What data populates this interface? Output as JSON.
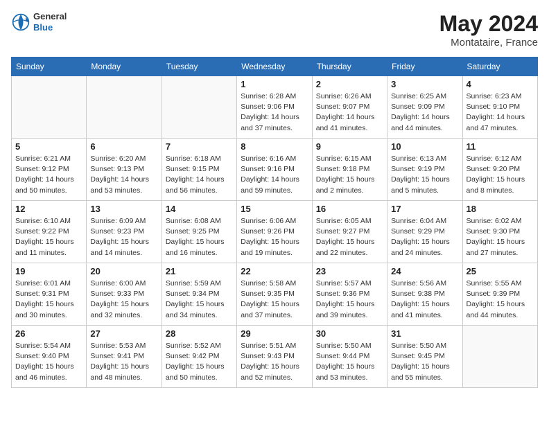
{
  "header": {
    "logo_line1": "General",
    "logo_line2": "Blue",
    "month_year": "May 2024",
    "location": "Montataire, France"
  },
  "weekdays": [
    "Sunday",
    "Monday",
    "Tuesday",
    "Wednesday",
    "Thursday",
    "Friday",
    "Saturday"
  ],
  "weeks": [
    [
      {
        "day": "",
        "info": ""
      },
      {
        "day": "",
        "info": ""
      },
      {
        "day": "",
        "info": ""
      },
      {
        "day": "1",
        "info": "Sunrise: 6:28 AM\nSunset: 9:06 PM\nDaylight: 14 hours\nand 37 minutes."
      },
      {
        "day": "2",
        "info": "Sunrise: 6:26 AM\nSunset: 9:07 PM\nDaylight: 14 hours\nand 41 minutes."
      },
      {
        "day": "3",
        "info": "Sunrise: 6:25 AM\nSunset: 9:09 PM\nDaylight: 14 hours\nand 44 minutes."
      },
      {
        "day": "4",
        "info": "Sunrise: 6:23 AM\nSunset: 9:10 PM\nDaylight: 14 hours\nand 47 minutes."
      }
    ],
    [
      {
        "day": "5",
        "info": "Sunrise: 6:21 AM\nSunset: 9:12 PM\nDaylight: 14 hours\nand 50 minutes."
      },
      {
        "day": "6",
        "info": "Sunrise: 6:20 AM\nSunset: 9:13 PM\nDaylight: 14 hours\nand 53 minutes."
      },
      {
        "day": "7",
        "info": "Sunrise: 6:18 AM\nSunset: 9:15 PM\nDaylight: 14 hours\nand 56 minutes."
      },
      {
        "day": "8",
        "info": "Sunrise: 6:16 AM\nSunset: 9:16 PM\nDaylight: 14 hours\nand 59 minutes."
      },
      {
        "day": "9",
        "info": "Sunrise: 6:15 AM\nSunset: 9:18 PM\nDaylight: 15 hours\nand 2 minutes."
      },
      {
        "day": "10",
        "info": "Sunrise: 6:13 AM\nSunset: 9:19 PM\nDaylight: 15 hours\nand 5 minutes."
      },
      {
        "day": "11",
        "info": "Sunrise: 6:12 AM\nSunset: 9:20 PM\nDaylight: 15 hours\nand 8 minutes."
      }
    ],
    [
      {
        "day": "12",
        "info": "Sunrise: 6:10 AM\nSunset: 9:22 PM\nDaylight: 15 hours\nand 11 minutes."
      },
      {
        "day": "13",
        "info": "Sunrise: 6:09 AM\nSunset: 9:23 PM\nDaylight: 15 hours\nand 14 minutes."
      },
      {
        "day": "14",
        "info": "Sunrise: 6:08 AM\nSunset: 9:25 PM\nDaylight: 15 hours\nand 16 minutes."
      },
      {
        "day": "15",
        "info": "Sunrise: 6:06 AM\nSunset: 9:26 PM\nDaylight: 15 hours\nand 19 minutes."
      },
      {
        "day": "16",
        "info": "Sunrise: 6:05 AM\nSunset: 9:27 PM\nDaylight: 15 hours\nand 22 minutes."
      },
      {
        "day": "17",
        "info": "Sunrise: 6:04 AM\nSunset: 9:29 PM\nDaylight: 15 hours\nand 24 minutes."
      },
      {
        "day": "18",
        "info": "Sunrise: 6:02 AM\nSunset: 9:30 PM\nDaylight: 15 hours\nand 27 minutes."
      }
    ],
    [
      {
        "day": "19",
        "info": "Sunrise: 6:01 AM\nSunset: 9:31 PM\nDaylight: 15 hours\nand 30 minutes."
      },
      {
        "day": "20",
        "info": "Sunrise: 6:00 AM\nSunset: 9:33 PM\nDaylight: 15 hours\nand 32 minutes."
      },
      {
        "day": "21",
        "info": "Sunrise: 5:59 AM\nSunset: 9:34 PM\nDaylight: 15 hours\nand 34 minutes."
      },
      {
        "day": "22",
        "info": "Sunrise: 5:58 AM\nSunset: 9:35 PM\nDaylight: 15 hours\nand 37 minutes."
      },
      {
        "day": "23",
        "info": "Sunrise: 5:57 AM\nSunset: 9:36 PM\nDaylight: 15 hours\nand 39 minutes."
      },
      {
        "day": "24",
        "info": "Sunrise: 5:56 AM\nSunset: 9:38 PM\nDaylight: 15 hours\nand 41 minutes."
      },
      {
        "day": "25",
        "info": "Sunrise: 5:55 AM\nSunset: 9:39 PM\nDaylight: 15 hours\nand 44 minutes."
      }
    ],
    [
      {
        "day": "26",
        "info": "Sunrise: 5:54 AM\nSunset: 9:40 PM\nDaylight: 15 hours\nand 46 minutes."
      },
      {
        "day": "27",
        "info": "Sunrise: 5:53 AM\nSunset: 9:41 PM\nDaylight: 15 hours\nand 48 minutes."
      },
      {
        "day": "28",
        "info": "Sunrise: 5:52 AM\nSunset: 9:42 PM\nDaylight: 15 hours\nand 50 minutes."
      },
      {
        "day": "29",
        "info": "Sunrise: 5:51 AM\nSunset: 9:43 PM\nDaylight: 15 hours\nand 52 minutes."
      },
      {
        "day": "30",
        "info": "Sunrise: 5:50 AM\nSunset: 9:44 PM\nDaylight: 15 hours\nand 53 minutes."
      },
      {
        "day": "31",
        "info": "Sunrise: 5:50 AM\nSunset: 9:45 PM\nDaylight: 15 hours\nand 55 minutes."
      },
      {
        "day": "",
        "info": ""
      }
    ]
  ]
}
